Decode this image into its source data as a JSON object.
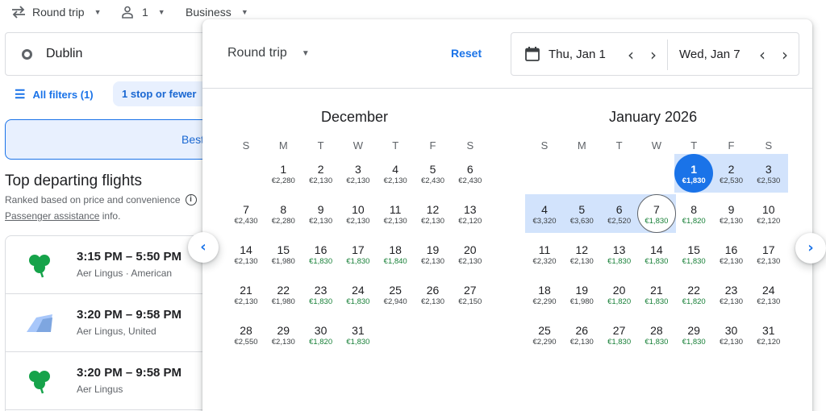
{
  "topbar": {
    "trip_type": "Round trip",
    "passengers": "1",
    "cabin": "Business"
  },
  "search": {
    "origin": "Dublin"
  },
  "filters": {
    "all_filters": "All filters (1)",
    "stops_chip": "1 stop or fewer"
  },
  "results": {
    "best_tab": "Best",
    "section_title": "Top departing flights",
    "section_sub": "Ranked based on price and convenience",
    "assist_link": "Passenger assistance",
    "assist_suffix": " info.",
    "flights": [
      {
        "time": "3:15 PM – 5:50 PM",
        "airline": "Aer Lingus · American",
        "logo": "shamrock-icon"
      },
      {
        "time": "3:20 PM – 9:58 PM",
        "airline": "Aer Lingus, United",
        "logo": "multi-airline-icon"
      },
      {
        "time": "3:20 PM – 9:58 PM",
        "airline": "Aer Lingus",
        "logo": "shamrock-icon"
      }
    ]
  },
  "calendar": {
    "trip_type": "Round trip",
    "reset_label": "Reset",
    "depart_date": "Thu, Jan 1",
    "return_date": "Wed, Jan 7",
    "weekdays": [
      "S",
      "M",
      "T",
      "W",
      "T",
      "F",
      "S"
    ],
    "months": [
      {
        "title": "December",
        "first_weekday": 1,
        "days": [
          {
            "d": "1",
            "p": "€2,280",
            "low": false
          },
          {
            "d": "2",
            "p": "€2,130",
            "low": false
          },
          {
            "d": "3",
            "p": "€2,130",
            "low": false
          },
          {
            "d": "4",
            "p": "€2,130",
            "low": false
          },
          {
            "d": "5",
            "p": "€2,430",
            "low": false
          },
          {
            "d": "6",
            "p": "€2,430",
            "low": false
          },
          {
            "d": "7",
            "p": "€2,430",
            "low": false
          },
          {
            "d": "8",
            "p": "€2,280",
            "low": false
          },
          {
            "d": "9",
            "p": "€2,130",
            "low": false
          },
          {
            "d": "10",
            "p": "€2,130",
            "low": false
          },
          {
            "d": "11",
            "p": "€2,130",
            "low": false
          },
          {
            "d": "12",
            "p": "€2,130",
            "low": false
          },
          {
            "d": "13",
            "p": "€2,120",
            "low": false
          },
          {
            "d": "14",
            "p": "€2,130",
            "low": false
          },
          {
            "d": "15",
            "p": "€1,980",
            "low": false
          },
          {
            "d": "16",
            "p": "€1,830",
            "low": true
          },
          {
            "d": "17",
            "p": "€1,830",
            "low": true
          },
          {
            "d": "18",
            "p": "€1,840",
            "low": true
          },
          {
            "d": "19",
            "p": "€2,130",
            "low": false
          },
          {
            "d": "20",
            "p": "€2,130",
            "low": false
          },
          {
            "d": "21",
            "p": "€2,130",
            "low": false
          },
          {
            "d": "22",
            "p": "€1,980",
            "low": false
          },
          {
            "d": "23",
            "p": "€1,830",
            "low": true
          },
          {
            "d": "24",
            "p": "€1,830",
            "low": true
          },
          {
            "d": "25",
            "p": "€2,940",
            "low": false
          },
          {
            "d": "26",
            "p": "€2,130",
            "low": false
          },
          {
            "d": "27",
            "p": "€2,150",
            "low": false
          },
          {
            "d": "28",
            "p": "€2,550",
            "low": false
          },
          {
            "d": "29",
            "p": "€2,130",
            "low": false
          },
          {
            "d": "30",
            "p": "€1,820",
            "low": true
          },
          {
            "d": "31",
            "p": "€1,830",
            "low": true
          }
        ]
      },
      {
        "title": "January 2026",
        "first_weekday": 4,
        "days": [
          {
            "d": "1",
            "p": "€1,830",
            "low": false
          },
          {
            "d": "2",
            "p": "€2,530",
            "low": false
          },
          {
            "d": "3",
            "p": "€2,530",
            "low": false
          },
          {
            "d": "4",
            "p": "€3,320",
            "low": false
          },
          {
            "d": "5",
            "p": "€3,630",
            "low": false
          },
          {
            "d": "6",
            "p": "€2,520",
            "low": false
          },
          {
            "d": "7",
            "p": "€1,830",
            "low": true
          },
          {
            "d": "8",
            "p": "€1,820",
            "low": true
          },
          {
            "d": "9",
            "p": "€2,130",
            "low": false
          },
          {
            "d": "10",
            "p": "€2,120",
            "low": false
          },
          {
            "d": "11",
            "p": "€2,320",
            "low": false
          },
          {
            "d": "12",
            "p": "€2,130",
            "low": false
          },
          {
            "d": "13",
            "p": "€1,830",
            "low": true
          },
          {
            "d": "14",
            "p": "€1,830",
            "low": true
          },
          {
            "d": "15",
            "p": "€1,830",
            "low": true
          },
          {
            "d": "16",
            "p": "€2,130",
            "low": false
          },
          {
            "d": "17",
            "p": "€2,130",
            "low": false
          },
          {
            "d": "18",
            "p": "€2,290",
            "low": false
          },
          {
            "d": "19",
            "p": "€1,980",
            "low": false
          },
          {
            "d": "20",
            "p": "€1,820",
            "low": true
          },
          {
            "d": "21",
            "p": "€1,830",
            "low": true
          },
          {
            "d": "22",
            "p": "€1,820",
            "low": true
          },
          {
            "d": "23",
            "p": "€2,130",
            "low": false
          },
          {
            "d": "24",
            "p": "€2,130",
            "low": false
          },
          {
            "d": "25",
            "p": "€2,290",
            "low": false
          },
          {
            "d": "26",
            "p": "€2,130",
            "low": false
          },
          {
            "d": "27",
            "p": "€1,830",
            "low": true
          },
          {
            "d": "28",
            "p": "€1,830",
            "low": true
          },
          {
            "d": "29",
            "p": "€1,830",
            "low": true
          },
          {
            "d": "30",
            "p": "€2,130",
            "low": false
          },
          {
            "d": "31",
            "p": "€2,120",
            "low": false
          }
        ],
        "selected_start": 1,
        "selected_end": 7
      }
    ]
  },
  "colors": {
    "accent": "#1a73e8",
    "range": "#d2e3fc",
    "low_price": "#188038"
  }
}
